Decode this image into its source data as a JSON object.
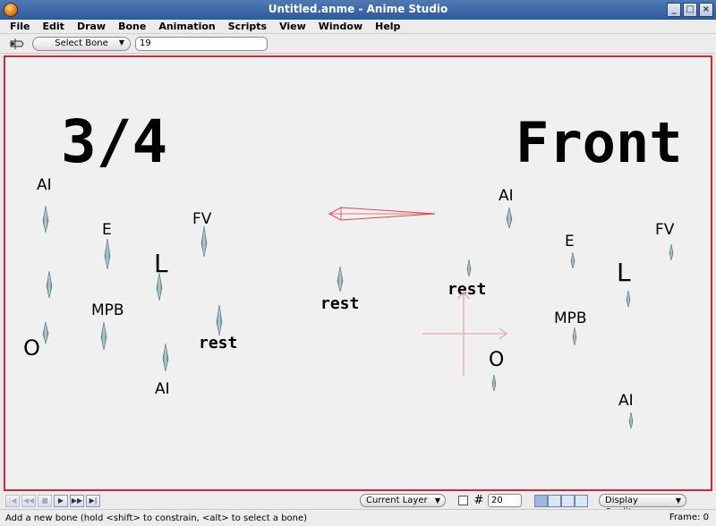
{
  "window": {
    "title": "Untitled.anme - Anime Studio",
    "buttons": [
      "_",
      "□",
      "×"
    ]
  },
  "menu": [
    "File",
    "Edit",
    "Draw",
    "Bone",
    "Animation",
    "Scripts",
    "View",
    "Window",
    "Help"
  ],
  "toolbar": {
    "tool_icon": "add-bone-icon",
    "select_bone_label": "Select Bone",
    "value_field": "19"
  },
  "canvas": {
    "labels": {
      "three_quarter": "3/4",
      "front": "Front",
      "rest_left": "rest",
      "rest_center": "rest",
      "rest_right": "rest",
      "left_ai_top": "AI",
      "left_e": "E",
      "left_fv": "FV",
      "left_l": "L",
      "left_mpb": "MPB",
      "left_o": "O",
      "left_ai_bottom": "AI",
      "right_ai_top": "AI",
      "right_e": "E",
      "right_fv": "FV",
      "right_l": "L",
      "right_mpb": "MPB",
      "right_o": "O",
      "right_ai_bottom": "AI"
    },
    "colors": {
      "frame_border": "#cc2a3a",
      "bone_fill": "#7aa2a6",
      "selected_bone": "#e04a4a",
      "origin_axes": "#e6a8a8"
    }
  },
  "bottombar": {
    "playback_icons": [
      "rewind-to-start-icon",
      "step-back-icon",
      "stop-icon",
      "play-icon",
      "step-forward-icon",
      "skip-to-end-icon"
    ],
    "layer_dropdown": "Current Layer",
    "grid_size": "20",
    "quality_dropdown": "Display Quality"
  },
  "status": {
    "message": "Add a new bone (hold <shift> to constrain, <alt> to select a bone)",
    "frame": "Frame: 0"
  }
}
